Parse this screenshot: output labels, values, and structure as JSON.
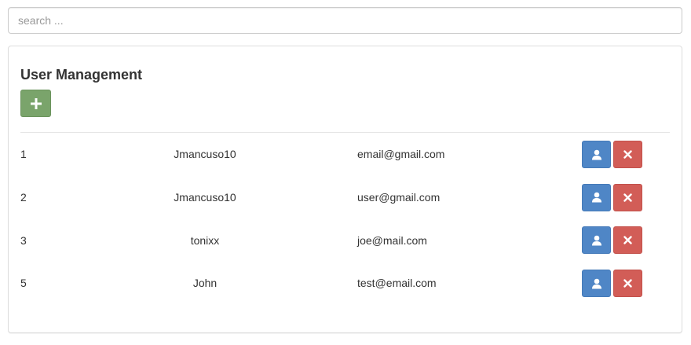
{
  "search": {
    "placeholder": "search ..."
  },
  "panel": {
    "title": "User Management",
    "add_button_icon": "plus-icon"
  },
  "users": [
    {
      "id": "1",
      "username": "Jmancuso10",
      "email": "email@gmail.com"
    },
    {
      "id": "2",
      "username": "Jmancuso10",
      "email": "user@gmail.com"
    },
    {
      "id": "3",
      "username": "tonixx",
      "email": "joe@mail.com"
    },
    {
      "id": "5",
      "username": "John",
      "email": "test@email.com"
    }
  ],
  "row_actions": {
    "view_icon": "user-icon",
    "delete_icon": "close-icon"
  },
  "colors": {
    "add": "#7aa46b",
    "view": "#4f86c6",
    "delete": "#d25d57"
  }
}
